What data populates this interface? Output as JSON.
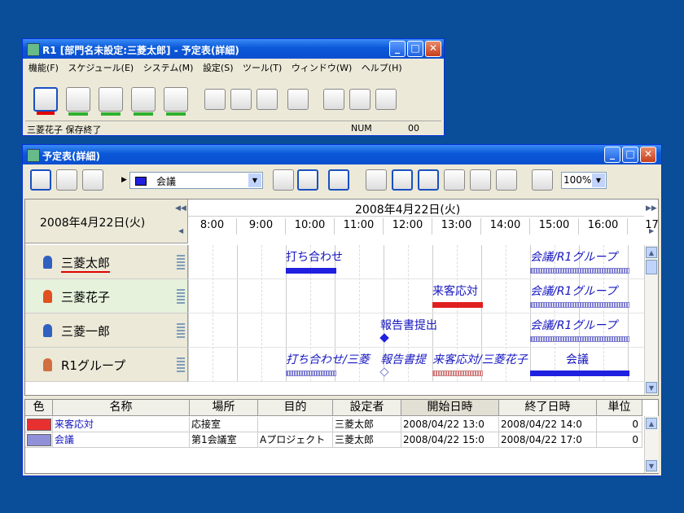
{
  "main_window": {
    "title": "R1 [部門名未設定:三菱太郎] - 予定表(詳細)",
    "menu": [
      "機能(F)",
      "スケジュール(E)",
      "システム(M)",
      "設定(S)",
      "ツール(T)",
      "ウィンドウ(W)",
      "ヘルプ(H)"
    ],
    "status_text": "三菱花子 保存終了",
    "status_num": "NUM",
    "status_code": "00",
    "tool_bar_colors": [
      "#e00000",
      "#30b030",
      "#30b030",
      "#30b030",
      "#30b030"
    ]
  },
  "schedule_window": {
    "title": "予定表(詳細)",
    "category_select": "会議",
    "zoom_select": "100%",
    "date_label": "2008年4月22日(火)",
    "header_date": "2008年4月22日(火)",
    "hours": [
      "8:00",
      "9:00",
      "10:00",
      "11:00",
      "12:00",
      "13:00",
      "14:00",
      "15:00",
      "16:00",
      "17"
    ],
    "people": [
      {
        "name": "三菱太郎",
        "icon_color": "#3060c0"
      },
      {
        "name": "三菱花子",
        "icon_color": "#e05020"
      },
      {
        "name": "三菱一郎",
        "icon_color": "#3060c0"
      },
      {
        "name": "R1グループ",
        "icon_color": "#d07040"
      }
    ],
    "events": [
      {
        "row": 0,
        "label": "打ち合わせ",
        "italic": false,
        "start": 10.0,
        "end": 11.0,
        "color": "#2020e0"
      },
      {
        "row": 0,
        "label": "会議/R1グループ",
        "italic": true,
        "start": 15.0,
        "end": 17.0,
        "color": "#8080d0"
      },
      {
        "row": 1,
        "label": "来客応対",
        "italic": false,
        "start": 13.0,
        "end": 14.0,
        "color": "#e02020"
      },
      {
        "row": 1,
        "label": "会議/R1グループ",
        "italic": true,
        "start": 15.0,
        "end": 17.0,
        "color": "#8080d0"
      },
      {
        "row": 2,
        "label": "報告書提出",
        "italic": false,
        "start": 12.0,
        "end": 12.0,
        "color": "#2020e0"
      },
      {
        "row": 2,
        "label": "会議/R1グループ",
        "italic": true,
        "start": 15.0,
        "end": 17.0,
        "color": "#8080d0"
      },
      {
        "row": 3,
        "label": "打ち合わせ/三菱",
        "italic": true,
        "start": 10.0,
        "end": 11.0,
        "color": "#8080d0"
      },
      {
        "row": 3,
        "label": "報告書提",
        "italic": true,
        "start": 12.0,
        "end": 12.0,
        "color": "#8080d0"
      },
      {
        "row": 3,
        "label": "来客応対/三菱花子",
        "italic": true,
        "start": 13.0,
        "end": 14.0,
        "color": "#d08080"
      },
      {
        "row": 3,
        "label": "会議",
        "italic": false,
        "start": 15.0,
        "end": 17.0,
        "color": "#2020e0"
      }
    ],
    "table": {
      "columns": [
        "色",
        "名称",
        "場所",
        "目的",
        "設定者",
        "開始日時",
        "終了日時",
        "単位"
      ],
      "rows": [
        {
          "color": "#e83030",
          "name": "来客応対",
          "place": "応接室",
          "purpose": "",
          "setter": "三菱太郎",
          "start": "2008/04/22 13:0",
          "end": "2008/04/22 14:0",
          "unit": "0"
        },
        {
          "color": "#9090d8",
          "name": "会議",
          "place": "第1会議室",
          "purpose": "Aプロジェクト",
          "setter": "三菱太郎",
          "start": "2008/04/22 15:0",
          "end": "2008/04/22 17:0",
          "unit": "0"
        }
      ]
    }
  }
}
